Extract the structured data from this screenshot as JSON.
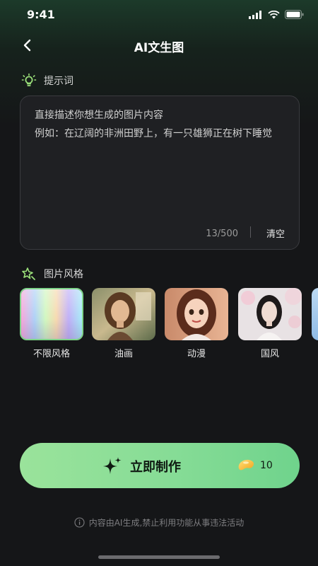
{
  "status_bar": {
    "time": "9:41"
  },
  "nav": {
    "title": "AI文生图"
  },
  "prompt": {
    "section_label": "提示词",
    "placeholder": "直接描述你想生成的图片内容",
    "text": "例如：在辽阔的非洲田野上，有一只雄狮正在树下睡觉",
    "counter": "13/500",
    "clear_label": "清空"
  },
  "styles": {
    "section_label": "图片风格",
    "items": [
      {
        "label": "不限风格",
        "selected": true
      },
      {
        "label": "油画",
        "selected": false
      },
      {
        "label": "动漫",
        "selected": false
      },
      {
        "label": "国风",
        "selected": false
      }
    ]
  },
  "cta": {
    "label": "立即制作",
    "cost": "10"
  },
  "disclaimer": "内容由AI生成,禁止利用功能从事违法活动",
  "colors": {
    "accent": "#86dc96",
    "background": "#151618",
    "panel": "#1f2023"
  }
}
